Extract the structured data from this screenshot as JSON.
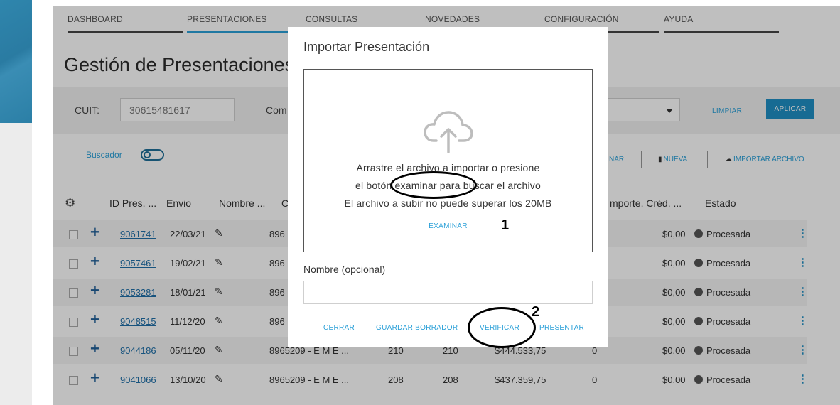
{
  "nav": {
    "tabs": [
      {
        "label": "DASHBOARD",
        "active": false
      },
      {
        "label": "PRESENTACIONES",
        "active": true
      },
      {
        "label": "CONSULTAS",
        "active": false
      },
      {
        "label": "NOVEDADES",
        "active": false
      },
      {
        "label": "CONFIGURACIÓN",
        "active": false
      },
      {
        "label": "AYUDA",
        "active": false
      }
    ]
  },
  "page": {
    "title": "Gestión de Presentaciones"
  },
  "filters": {
    "cuit_label": "CUIT:",
    "cuit_value": "30615481617",
    "second_label": "Com",
    "limpiar": "LIMPIAR",
    "aplicar": "APLICAR"
  },
  "toolbar": {
    "buscador": "Buscador",
    "partial_action": "NAR",
    "nueva": "NUEVA",
    "importar": "IMPORTAR ARCHIVO"
  },
  "table": {
    "headers": [
      "ID Pres. ...",
      "Envio",
      "Nombre ...",
      "C",
      "mporte. Créd. ...",
      "Estado"
    ],
    "rows": [
      {
        "id": "9061741",
        "envio": "22/03/21",
        "nombre": "896",
        "c1": "",
        "c2": "",
        "importe": "",
        "c4": "",
        "cred": "$0,00",
        "estado": "Procesada"
      },
      {
        "id": "9057461",
        "envio": "19/02/21",
        "nombre": "896",
        "c1": "",
        "c2": "",
        "importe": "",
        "c4": "",
        "cred": "$0,00",
        "estado": "Procesada"
      },
      {
        "id": "9053281",
        "envio": "18/01/21",
        "nombre": "896",
        "c1": "",
        "c2": "",
        "importe": "",
        "c4": "",
        "cred": "$0,00",
        "estado": "Procesada"
      },
      {
        "id": "9048515",
        "envio": "11/12/20",
        "nombre": "896",
        "c1": "",
        "c2": "",
        "importe": "",
        "c4": "",
        "cred": "$0,00",
        "estado": "Procesada"
      },
      {
        "id": "9044186",
        "envio": "05/11/20",
        "nombre": "8965209 - E M E ...",
        "c1": "210",
        "c2": "210",
        "importe": "$444.533,75",
        "c4": "0",
        "cred": "$0,00",
        "estado": "Procesada"
      },
      {
        "id": "9041066",
        "envio": "13/10/20",
        "nombre": "8965209 - E M E ...",
        "c1": "208",
        "c2": "208",
        "importe": "$437.359,75",
        "c4": "0",
        "cred": "$0,00",
        "estado": "Procesada"
      }
    ]
  },
  "modal": {
    "title": "Importar Presentación",
    "drop_line1": "Arrastre el archivo a importar o presione",
    "drop_line2": "el botón examinar para buscar el archivo",
    "drop_line3": "El archivo a subir no puede superar los 20MB",
    "examinar": "EXAMINAR",
    "nombre_label": "Nombre (opcional)",
    "buttons": {
      "cerrar": "CERRAR",
      "guardar": "GUARDAR BORRADOR",
      "verificar": "VERIFICAR",
      "presentar": "PRESENTAR"
    }
  },
  "annotations": {
    "marker1": "1",
    "marker2": "2"
  },
  "colors": {
    "accent": "#2aa0d8",
    "primary_button": "#1f8fc4",
    "brand": "#2b7fa6"
  }
}
